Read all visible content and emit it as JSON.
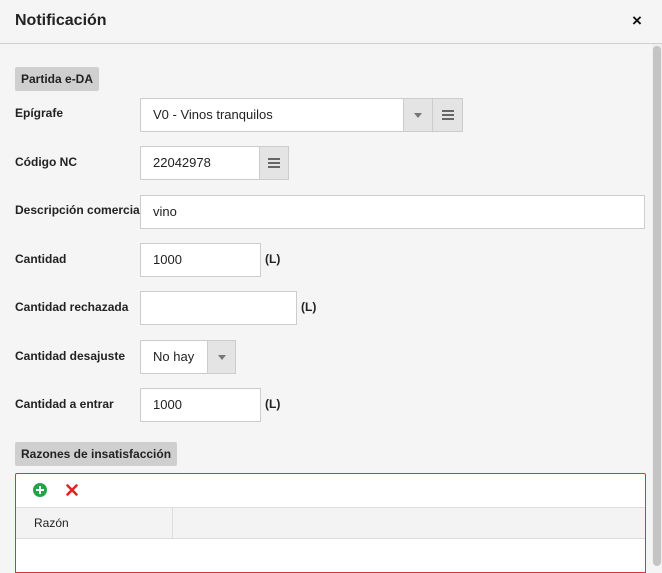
{
  "dialog": {
    "title": "Notificación",
    "close": "×"
  },
  "sections": {
    "partida": "Partida e-DA",
    "razones": "Razones de insatisfacción"
  },
  "fields": {
    "epigrafe": {
      "label": "Epígrafe",
      "value": "V0 - Vinos tranquilos"
    },
    "codigo_nc": {
      "label": "Código NC",
      "value": "22042978"
    },
    "descripcion": {
      "label": "Descripción comercial",
      "value": "vino"
    },
    "cantidad": {
      "label": "Cantidad",
      "value": "1000",
      "unit": "(L)"
    },
    "cantidad_rechazada": {
      "label": "Cantidad rechazada",
      "value": "",
      "unit": "(L)"
    },
    "cantidad_desajuste": {
      "label": "Cantidad desajuste",
      "value": "No hay"
    },
    "cantidad_entrar": {
      "label": "Cantidad a entrar",
      "value": "1000",
      "unit": "(L)"
    }
  },
  "grid": {
    "columns": [
      "Razón",
      ""
    ],
    "add_icon": "plus-circle-icon",
    "delete_icon": "x-icon"
  },
  "colors": {
    "add": "#22a447",
    "delete": "#e02424",
    "grid_border": "#d8343a"
  }
}
